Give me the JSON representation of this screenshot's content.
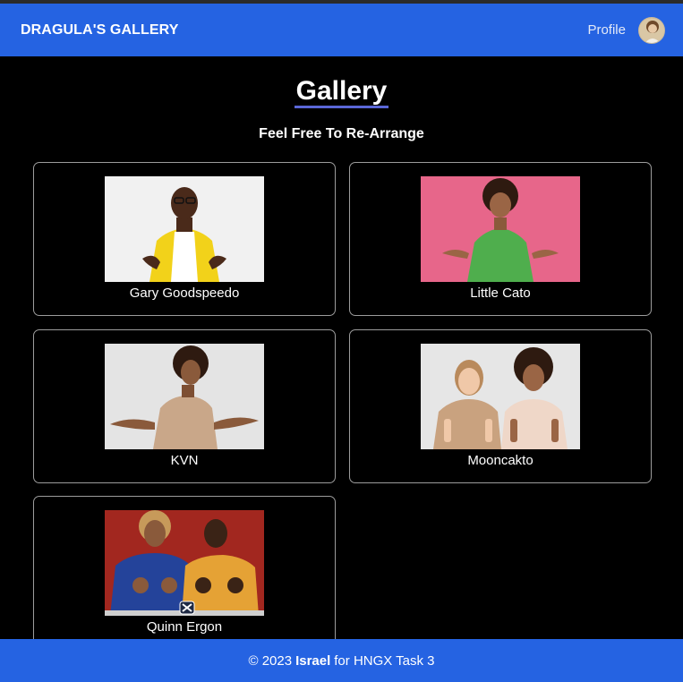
{
  "header": {
    "brand": "DRAGULA'S GALLERY",
    "profile_label": "Profile"
  },
  "main": {
    "title": "Gallery",
    "subtitle": "Feel Free To Re-Arrange",
    "items": [
      {
        "name": "Gary Goodspeedo"
      },
      {
        "name": "Little Cato"
      },
      {
        "name": "KVN"
      },
      {
        "name": "Mooncakto"
      },
      {
        "name": "Quinn Ergon"
      }
    ]
  },
  "footer": {
    "prefix": "© 2023",
    "author": "Israel",
    "suffix": "for HNGX Task 3"
  },
  "colors": {
    "header_bg": "#2563e2",
    "page_bg": "#000000",
    "card_border": "#9c9c9c",
    "title_underline": "#5a67d8"
  },
  "icons": {
    "avatar": "user-avatar",
    "drag_handle": "drag-cross-icon"
  }
}
